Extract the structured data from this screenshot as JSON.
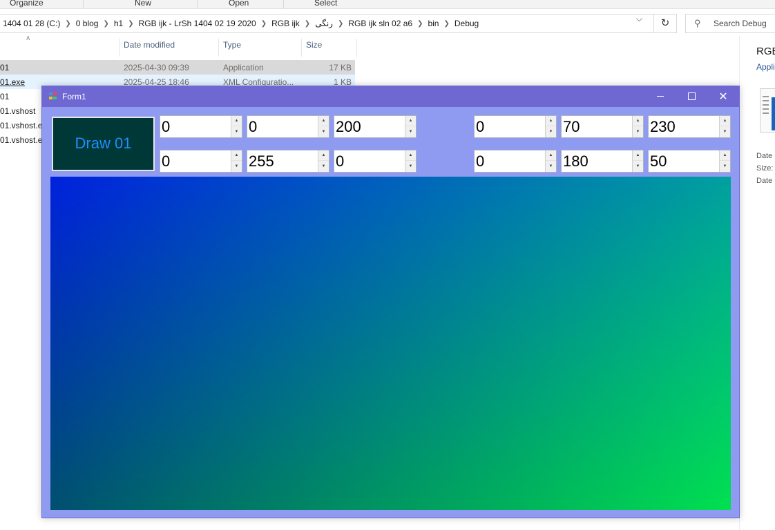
{
  "explorer": {
    "command_bar": [
      "Organize",
      "New",
      "Open",
      "Select"
    ],
    "breadcrumbs": [
      "1404 01 28 (C:)",
      "0 blog",
      "h1",
      "RGB ijk - LrSh 1404 02 19 2020",
      "RGB ijk",
      "رنگی",
      "RGB ijk sln 02 a6",
      "bin",
      "Debug"
    ],
    "search_placeholder": "Search Debug",
    "columns": {
      "date": "Date modified",
      "type": "Type",
      "size": "Size"
    },
    "files": [
      {
        "name": "01",
        "date": "2025-04-30 09:39",
        "type": "Application",
        "size": "17 KB"
      },
      {
        "name": "01.exe",
        "date": "2025-04-25 18:46",
        "type": "XML Configuratio...",
        "size": "1 KB"
      },
      {
        "name": "01"
      },
      {
        "name": "01.vshost"
      },
      {
        "name": "01.vshost.ex"
      },
      {
        "name": "01.vshost.ex"
      }
    ],
    "preview": {
      "title": "RGB",
      "subtitle": "Appli",
      "meta": [
        "Date",
        "Size:",
        "Date"
      ]
    }
  },
  "form": {
    "title": "Form1",
    "draw_button_label": "Draw 01",
    "spin_values_left": [
      [
        "0",
        "0",
        "200"
      ],
      [
        "0",
        "255",
        "0"
      ]
    ],
    "spin_values_right": [
      [
        "0",
        "70",
        "230"
      ],
      [
        "0",
        "180",
        "50"
      ]
    ],
    "colors": {
      "titlebar": "#6f68d2",
      "form_bg": "#8f9bf0",
      "button_bg": "#003838",
      "button_text": "#1e90ff",
      "corner_top_left": "#0022dd",
      "corner_top_right": "#00a0a0",
      "corner_bottom_left": "#00506e",
      "corner_bottom_right": "#00e050"
    }
  }
}
